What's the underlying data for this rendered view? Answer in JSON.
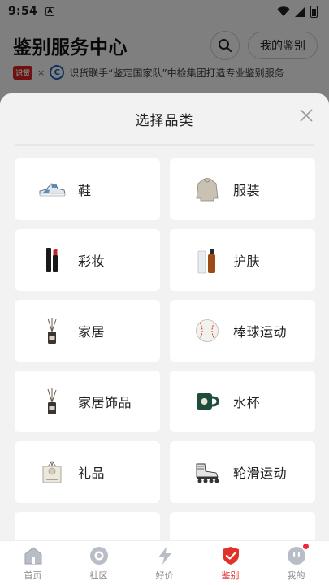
{
  "status_bar": {
    "time": "9:54",
    "notice_glyph": "A"
  },
  "header": {
    "title": "鉴别服务中心",
    "my_auth_label": "我的鉴别"
  },
  "partner": {
    "shihuo_logo": "识货",
    "separator": "×",
    "ccic_logo": "C",
    "text": "识货联手“鉴定国家队”中检集团打造专业鉴别服务"
  },
  "sheet": {
    "title": "选择品类",
    "categories": [
      {
        "label": "鞋",
        "icon": "sneaker-icon"
      },
      {
        "label": "服装",
        "icon": "hoodie-icon"
      },
      {
        "label": "彩妆",
        "icon": "lipstick-icon"
      },
      {
        "label": "护肤",
        "icon": "skincare-bottle-icon"
      },
      {
        "label": "家居",
        "icon": "diffuser-icon"
      },
      {
        "label": "棒球运动",
        "icon": "baseball-icon"
      },
      {
        "label": "家居饰品",
        "icon": "diffuser-icon"
      },
      {
        "label": "水杯",
        "icon": "mug-icon"
      },
      {
        "label": "礼品",
        "icon": "gift-icon"
      },
      {
        "label": "轮滑运动",
        "icon": "roller-skate-icon"
      },
      {
        "label": "",
        "icon": ""
      },
      {
        "label": "",
        "icon": ""
      }
    ]
  },
  "bottom_nav": {
    "items": [
      {
        "label": "首页",
        "icon": "home-icon",
        "active": false
      },
      {
        "label": "社区",
        "icon": "community-icon",
        "active": false
      },
      {
        "label": "好价",
        "icon": "lightning-icon",
        "active": false
      },
      {
        "label": "鉴别",
        "icon": "shield-check-icon",
        "active": true
      },
      {
        "label": "我的",
        "icon": "profile-icon",
        "active": false,
        "badge": true
      }
    ]
  },
  "colors": {
    "accent": "#e0322b",
    "sheet_bg": "#f2f2f2",
    "overlay": "rgba(0,0,0,0.5)"
  }
}
